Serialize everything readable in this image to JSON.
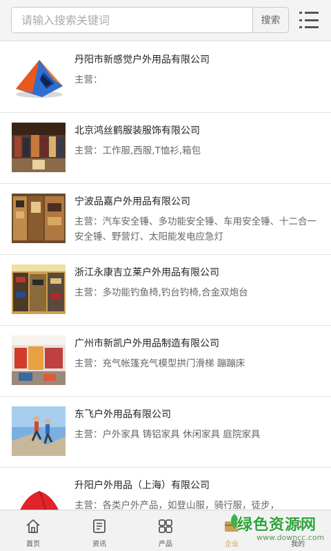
{
  "search": {
    "placeholder": "请输入搜索关键词",
    "button_label": "搜索"
  },
  "companies": [
    {
      "name": "丹阳市新感觉户外用品有限公司",
      "main": "主营："
    },
    {
      "name": "北京鸿丝鹤服装服饰有限公司",
      "main": "主营：工作服,西服,T恤衫,箱包"
    },
    {
      "name": "宁波品嘉户外用品有限公司",
      "main": "主营：汽车安全锤、多功能安全锤、车用安全锤、十二合一安全锤、野营灯、太阳能发电应急灯"
    },
    {
      "name": "浙江永康吉立莱户外用品有限公司",
      "main": "主营：多功能钓鱼椅,钓台钓椅,合金双炮台"
    },
    {
      "name": "广州市新凯户外用品制造有限公司",
      "main": "主营：充气帐篷充气模型拱门滑梯 蹦蹦床"
    },
    {
      "name": "东飞户外用品有限公司",
      "main": "主营：户外家具 铸铝家具 休闲家具 庭院家具"
    },
    {
      "name": "升阳户外用品（上海）有限公司",
      "main": "主营：各类户外产品，如登山服，骑行服，徒步，"
    }
  ],
  "nav": [
    {
      "label": "首页",
      "icon": "home-icon"
    },
    {
      "label": "资讯",
      "icon": "news-icon"
    },
    {
      "label": "产品",
      "icon": "grid-icon"
    },
    {
      "label": "企业",
      "icon": "company-icon"
    },
    {
      "label": "我的",
      "icon": "user-icon"
    }
  ],
  "watermark": {
    "title": "绿色资源网",
    "url": "www.downcc.com"
  },
  "colors": {
    "accent": "#c9a35a",
    "watermark_green": "#2da23a",
    "divider": "#e2e2e2"
  }
}
